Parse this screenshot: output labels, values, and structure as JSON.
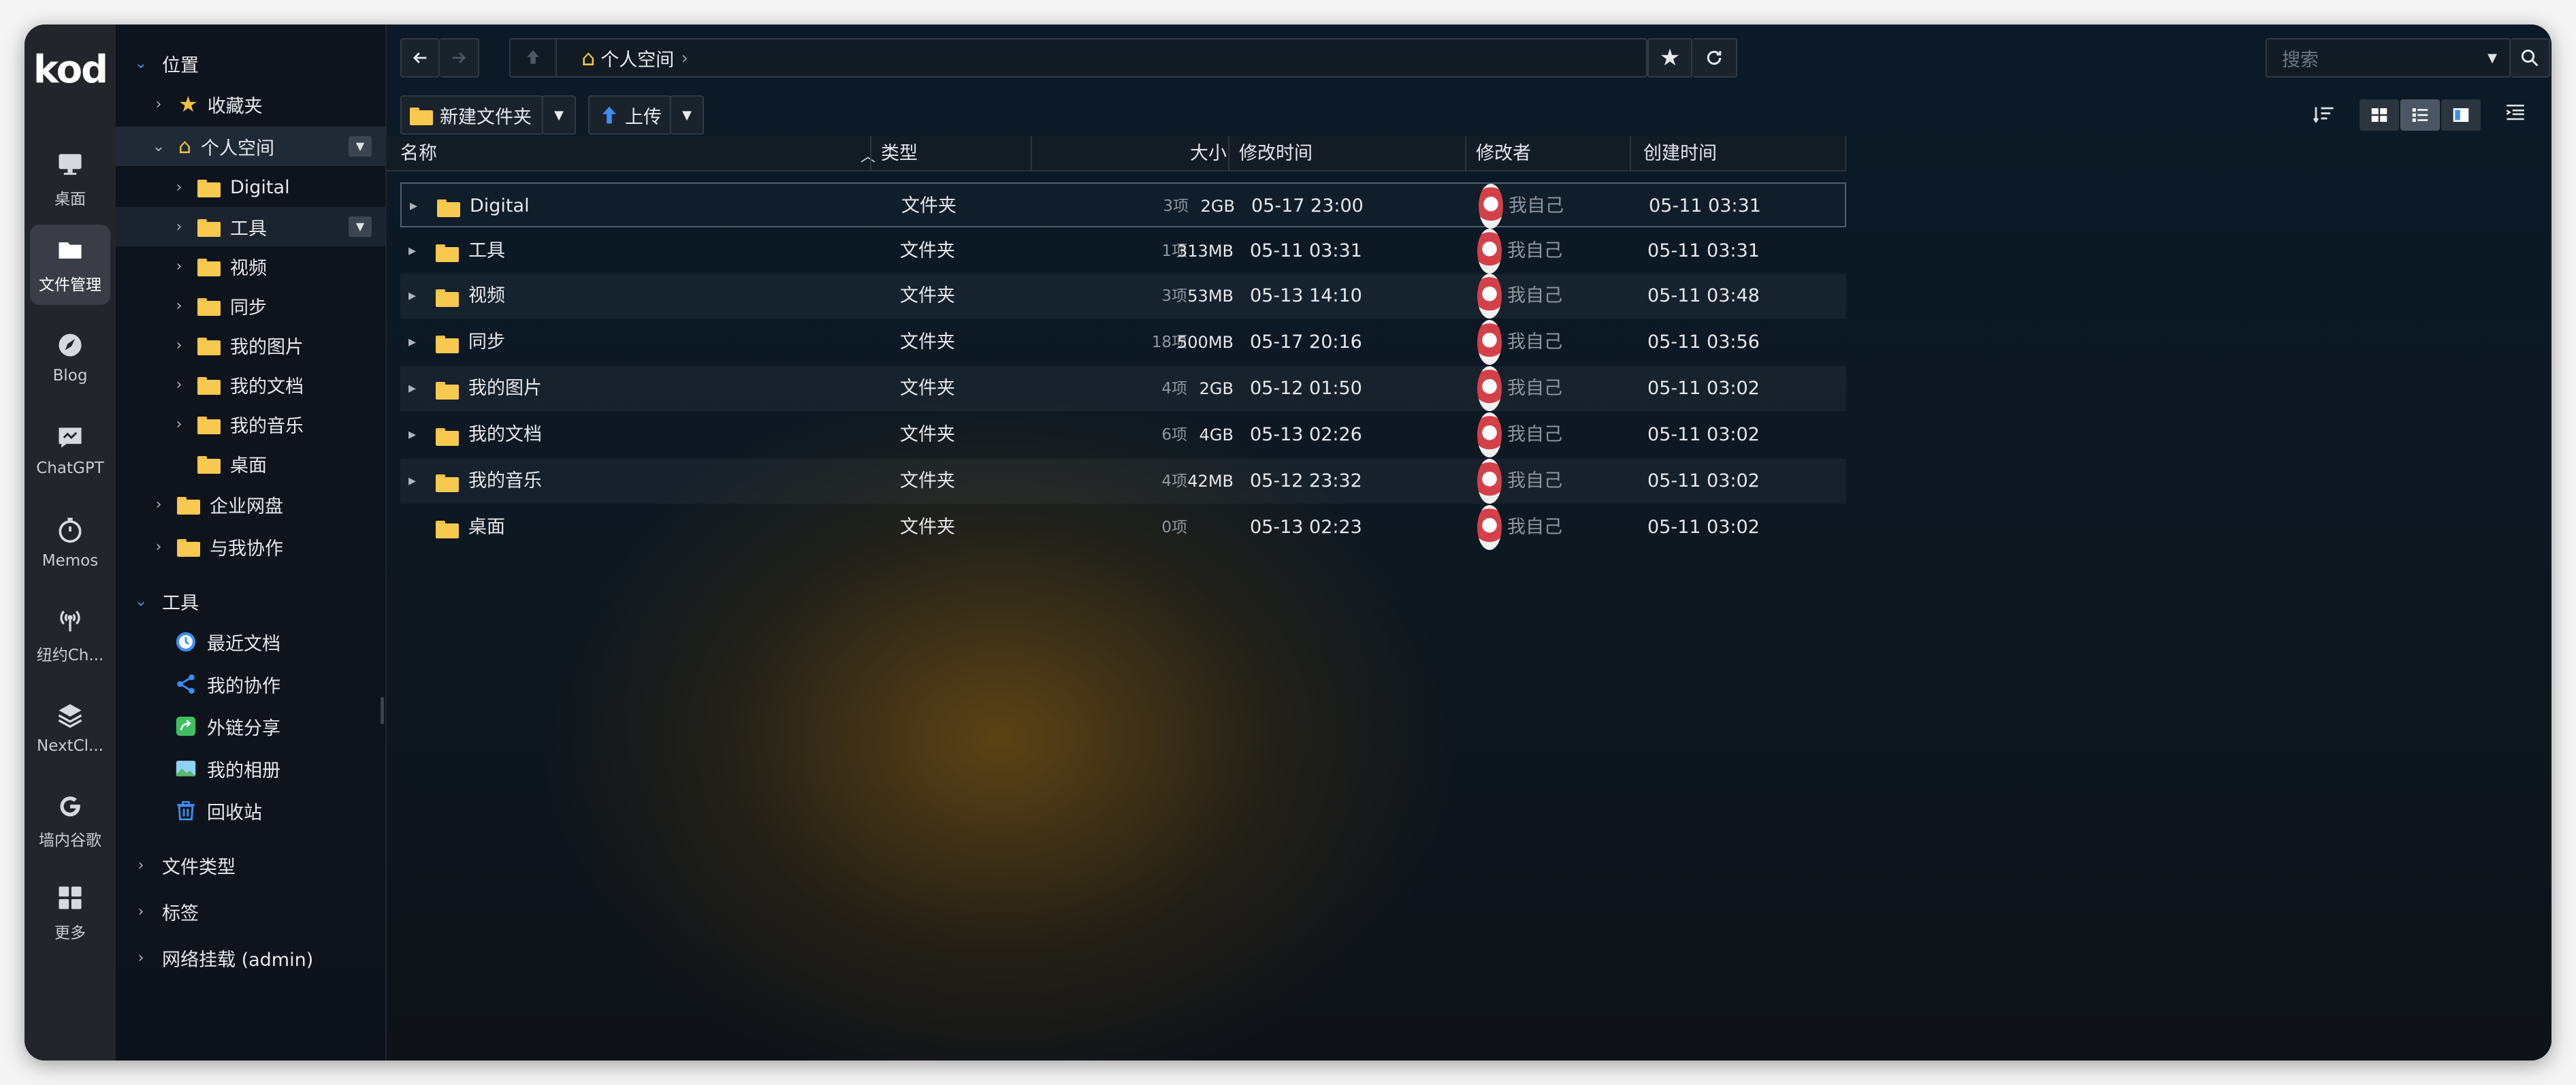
{
  "app": {
    "logo": "kod"
  },
  "rail": [
    {
      "label": "桌面",
      "icon": "desktop-icon"
    },
    {
      "label": "文件管理",
      "icon": "folder-icon",
      "active": true
    },
    {
      "label": "Blog",
      "icon": "blog-icon"
    },
    {
      "label": "ChatGPT",
      "icon": "chat-icon"
    },
    {
      "label": "Memos",
      "icon": "timer-icon"
    },
    {
      "label": "纽约Ch...",
      "icon": "broadcast-icon"
    },
    {
      "label": "NextCl...",
      "icon": "layers-icon"
    },
    {
      "label": "墙内谷歌",
      "icon": "google-icon"
    },
    {
      "label": "更多",
      "icon": "grid-icon"
    }
  ],
  "sidebar": {
    "section_location": "位置",
    "favorites": "收藏夹",
    "personal_space": "个人空间",
    "personal_children": [
      "Digital",
      "工具",
      "视频",
      "同步",
      "我的图片",
      "我的文档",
      "我的音乐",
      "桌面"
    ],
    "enterprise": "企业网盘",
    "shared_with_me": "与我协作",
    "section_tools": "工具",
    "tools": [
      {
        "label": "最近文档",
        "icon": "clock-icon",
        "color": "#3d8ef0"
      },
      {
        "label": "我的协作",
        "icon": "share-nodes-icon",
        "color": "#3d8ef0"
      },
      {
        "label": "外链分享",
        "icon": "external-share-icon",
        "color": "#3fbf5f"
      },
      {
        "label": "我的相册",
        "icon": "album-icon",
        "color": "#58b86b"
      },
      {
        "label": "回收站",
        "icon": "trash-icon",
        "color": "#3d8ef0"
      }
    ],
    "file_types": "文件类型",
    "tags": "标签",
    "network_mount": "网络挂载 (admin)"
  },
  "toolbar": {
    "breadcrumb": "个人空间",
    "new_folder": "新建文件夹",
    "upload": "上传",
    "search_placeholder": "搜索"
  },
  "columns": {
    "name": "名称",
    "type": "类型",
    "size": "大小",
    "modified": "修改时间",
    "modifier": "修改者",
    "created": "创建时间"
  },
  "files": [
    {
      "name": "Digital",
      "type": "文件夹",
      "count": "3项",
      "size": "2GB",
      "modified": "05-17 23:00",
      "modifier": "我自己",
      "created": "05-11 03:31"
    },
    {
      "name": "工具",
      "type": "文件夹",
      "count": "1项",
      "size": "313MB",
      "modified": "05-11 03:31",
      "modifier": "我自己",
      "created": "05-11 03:31"
    },
    {
      "name": "视频",
      "type": "文件夹",
      "count": "3项",
      "size": "53MB",
      "modified": "05-13 14:10",
      "modifier": "我自己",
      "created": "05-11 03:48"
    },
    {
      "name": "同步",
      "type": "文件夹",
      "count": "18项",
      "size": "500MB",
      "modified": "05-17 20:16",
      "modifier": "我自己",
      "created": "05-11 03:56"
    },
    {
      "name": "我的图片",
      "type": "文件夹",
      "count": "4项",
      "size": "2GB",
      "modified": "05-12 01:50",
      "modifier": "我自己",
      "created": "05-11 03:02"
    },
    {
      "name": "我的文档",
      "type": "文件夹",
      "count": "6项",
      "size": "4GB",
      "modified": "05-13 02:26",
      "modifier": "我自己",
      "created": "05-11 03:02"
    },
    {
      "name": "我的音乐",
      "type": "文件夹",
      "count": "4项",
      "size": "42MB",
      "modified": "05-12 23:32",
      "modifier": "我自己",
      "created": "05-11 03:02"
    },
    {
      "name": "桌面",
      "type": "文件夹",
      "count": "0项",
      "size": "",
      "modified": "05-13 02:23",
      "modifier": "我自己",
      "created": "05-11 03:02"
    }
  ],
  "colors": {
    "accent": "#4a90e2",
    "folder": "#f7c94f",
    "rail_bg": "#23252b"
  }
}
